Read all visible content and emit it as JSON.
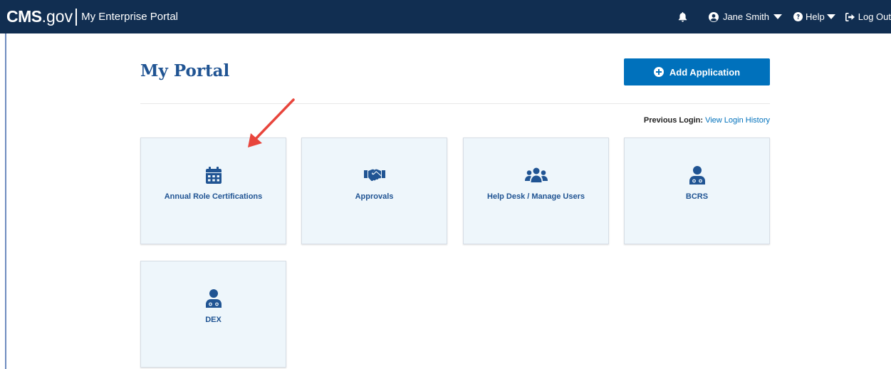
{
  "header": {
    "brand_cms": "CMS",
    "brand_gov": ".gov",
    "portal_name": "My Enterprise Portal",
    "user_name": "Jane Smith",
    "help_label": "Help",
    "logout_label": "Log Out"
  },
  "page": {
    "title": "My Portal",
    "add_button_label": "Add Application",
    "previous_login_label": "Previous Login:",
    "view_history_link": "View Login History"
  },
  "tiles": [
    {
      "label": "Annual Role Certifications",
      "icon": "calendar-icon"
    },
    {
      "label": "Approvals",
      "icon": "handshake-icon"
    },
    {
      "label": "Help Desk / Manage Users",
      "icon": "users-icon"
    },
    {
      "label": "BCRS",
      "icon": "doctor-icon"
    },
    {
      "label": "DEX",
      "icon": "doctor-icon"
    }
  ],
  "colors": {
    "header_bg": "#112e51",
    "primary": "#0071bc",
    "heading": "#205493",
    "tile_bg": "#eef6fb",
    "arrow": "#e8453c"
  }
}
